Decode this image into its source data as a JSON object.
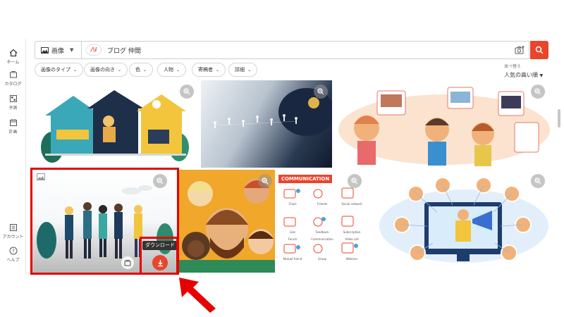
{
  "sidebar": {
    "items": [
      {
        "label": "ホーム",
        "icon": "home-icon"
      },
      {
        "label": "カタログ",
        "icon": "catalog-icon"
      },
      {
        "label": "予測",
        "icon": "forecast-icon"
      },
      {
        "label": "計画",
        "icon": "calendar-icon"
      }
    ],
    "bottom_items": [
      {
        "label": "アカウント",
        "icon": "account-icon"
      },
      {
        "label": "ヘルプ",
        "icon": "help-icon"
      }
    ]
  },
  "search": {
    "type_label": "画像",
    "query": "ブログ 仲間",
    "logo": "/\\i"
  },
  "filters": [
    "画像のタイプ",
    "画像の向き",
    "色",
    "人物",
    "寄稿者",
    "詳細"
  ],
  "sort": {
    "label": "並べ替え",
    "value": "人気の高い順"
  },
  "tooltip": {
    "download": "ダウンロード"
  },
  "communication_tile": {
    "title": "COMMUNICATION",
    "labels": [
      "Chart",
      "Friends",
      "Social network",
      "Like",
      "Feedback",
      "Subscription",
      "Forum",
      "Communication",
      "Video call",
      "Mutual friend",
      "Group",
      "Webinar"
    ]
  },
  "colors": {
    "accent": "#e8452c",
    "highlight": "#e60000"
  }
}
